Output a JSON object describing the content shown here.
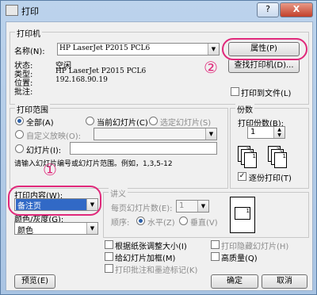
{
  "window": {
    "title": "打印",
    "help": "?",
    "close": "X"
  },
  "printer": {
    "group_label": "打印机",
    "name_label": "名称(N):",
    "name_value": "HP LaserJet P2015 PCL6",
    "properties_button": "属性(P)",
    "find_button": "查找打印机(D)...",
    "status_label": "状态:",
    "status_value": "空闲",
    "type_label": "类型:",
    "type_value": "HP LaserJet P2015 PCL6",
    "location_label": "位置:",
    "location_value": "192.168.90.19",
    "comment_label": "批注:",
    "print_to_file": "打印到文件(L)"
  },
  "range": {
    "group_label": "打印范围",
    "all": "全部(A)",
    "current": "当前幻灯片(C)",
    "selection": "选定幻灯片(S)",
    "custom": "自定义放映(O):",
    "slides": "幻灯片(I):",
    "hint": "请输入幻灯片编号或幻灯片范围。例如，1,3,5-12"
  },
  "copies": {
    "group_label": "份数",
    "count_label": "打印份数(B):",
    "count_value": "1",
    "collate": "逐份打印(T)",
    "page_labels": [
      "1",
      "2",
      "3",
      "1",
      "2",
      "3"
    ]
  },
  "content": {
    "print_what_label": "打印内容(W):",
    "print_what_value": "备注页",
    "color_label": "颜色/灰度(G):",
    "color_value": "颜色"
  },
  "handouts": {
    "group_label": "讲义",
    "per_page_label": "每页幻灯片数(E):",
    "per_page_value": "1",
    "order_label": "顺序:",
    "horizontal": "水平(Z)",
    "vertical": "垂直(V)",
    "preview_page_label": "1"
  },
  "options": {
    "scale": "根据纸张调整大小(I)",
    "frame": "给幻灯片加框(M)",
    "comments": "打印批注和墨迹标记(K)",
    "hidden": "打印隐藏幻灯片(H)",
    "quality": "高质量(Q)"
  },
  "footer": {
    "preview": "预览(E)",
    "ok": "确定",
    "cancel": "取消"
  },
  "annotations": {
    "one": "①",
    "two": "②"
  },
  "colors": {
    "highlight": "#e0287a",
    "selection": "#3169c6"
  }
}
